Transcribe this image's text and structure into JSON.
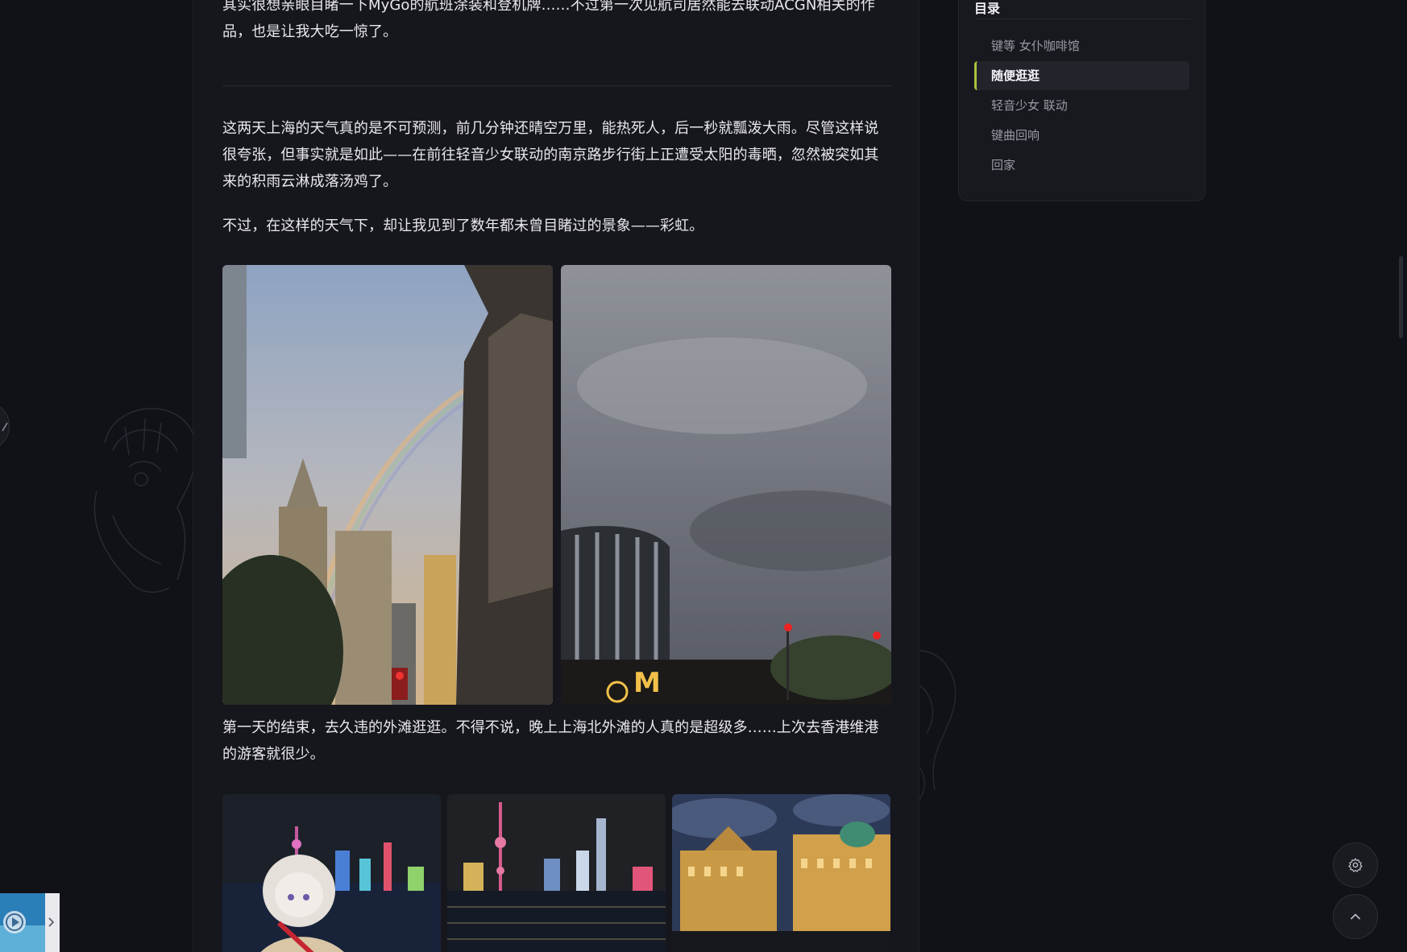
{
  "article": {
    "p1": "其实很想亲眼目睹一下MyGo的航班涂装和登机牌……不过第一次见航司居然能去联动ACGN相关的作品，也是让我大吃一惊了。",
    "p2": "这两天上海的天气真的是不可预测，前几分钟还晴空万里，能热死人，后一秒就瓢泼大雨。尽管这样说很夸张，但事实就是如此——在前往轻音少女联动的南京路步行街上正遭受太阳的毒晒，忽然被突如其来的积雨云淋成落汤鸡了。",
    "p3": "不过，在这样的天气下，却让我见到了数年都未曾目睹过的景象——彩虹。",
    "p4": "第一天的结束，去久违的外滩逛逛。不得不说，晚上上海北外滩的人真的是超级多……上次去香港维港的游客就很少。"
  },
  "toc": {
    "title": "目录",
    "items": [
      {
        "label": "键等 女仆咖啡馆",
        "active": false
      },
      {
        "label": "随便逛逛",
        "active": true
      },
      {
        "label": "轻音少女 联动",
        "active": false
      },
      {
        "label": "键曲回响",
        "active": false
      },
      {
        "label": "回家",
        "active": false
      }
    ]
  },
  "icons": {
    "settings": "gear-icon",
    "back_to_top": "chevron-up-icon",
    "left_tab": "pencil-icon",
    "player_next": "chevron-right-icon"
  },
  "colors": {
    "background": "#111118",
    "card": "#16161d",
    "accent": "#a9c23f",
    "text": "#e8e8ee",
    "muted": "#9a9aa6"
  }
}
